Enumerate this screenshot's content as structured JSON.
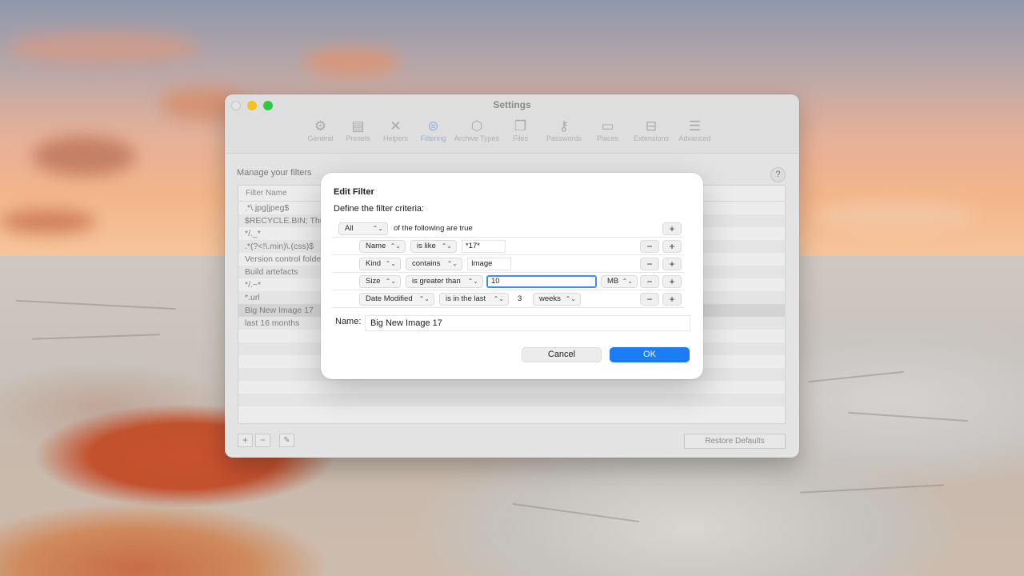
{
  "window": {
    "title": "Settings",
    "toolbar": [
      {
        "label": "General",
        "icon": "gear-icon",
        "glyph": "⚙"
      },
      {
        "label": "Presets",
        "icon": "list-icon",
        "glyph": "▤"
      },
      {
        "label": "Helpers",
        "icon": "tools-icon",
        "glyph": "✕"
      },
      {
        "label": "Filtering",
        "icon": "filter-icon",
        "glyph": "⊜",
        "active": true
      },
      {
        "label": "Archive Types",
        "icon": "box-icon",
        "glyph": "⬡"
      },
      {
        "label": "Files",
        "icon": "files-icon",
        "glyph": "❐"
      },
      {
        "label": "Passwords",
        "icon": "key-icon",
        "glyph": "⚷"
      },
      {
        "label": "Places",
        "icon": "folder-icon",
        "glyph": "▭"
      },
      {
        "label": "Extensions",
        "icon": "puzzle-icon",
        "glyph": "⊟"
      },
      {
        "label": "Advanced",
        "icon": "sliders-icon",
        "glyph": "☰"
      }
    ],
    "manage_label": "Manage your filters",
    "help": "?",
    "table": {
      "column_header": "Filter Name",
      "rows": [
        ".*\\.jpg|jpeg$",
        "$RECYCLE.BIN; Thu",
        "*/._*",
        ".*(?<!\\.min)\\.(css)$",
        "Version control folde",
        "Build artefacts",
        "*/.~*",
        "*.url",
        "Big New Image 17",
        "last 16 months"
      ],
      "selected_row": 8
    },
    "add": "+",
    "remove": "−",
    "edit": "✎",
    "restore_defaults": "Restore Defaults"
  },
  "dialog": {
    "title": "Edit Filter",
    "subtitle": "Define the filter criteria:",
    "match": {
      "quantifier": "All",
      "suffix": "of the following are true"
    },
    "criteria": [
      {
        "field": "Name",
        "operator": "is like",
        "value": "*17*"
      },
      {
        "field": "Kind",
        "operator": "contains",
        "value": "Image"
      },
      {
        "field": "Size",
        "operator": "is greater than",
        "value": "10",
        "unit": "MB"
      },
      {
        "field": "Date Modified",
        "operator": "is in the last",
        "value": "3",
        "unit": "weeks"
      }
    ],
    "plus": "+",
    "minus": "−",
    "name_label": "Name:",
    "name_value": "Big New Image 17",
    "cancel": "Cancel",
    "ok": "OK"
  },
  "colors": {
    "accent": "#1b7cf6",
    "focus_ring": "#3d8df5"
  }
}
